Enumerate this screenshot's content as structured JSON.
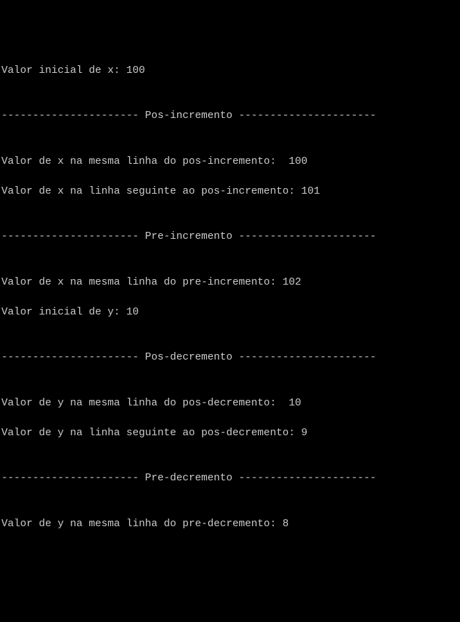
{
  "lines": {
    "l1": "Valor inicial de x: 100",
    "l2": "",
    "l3": "---------------------- Pos-incremento ----------------------",
    "l4": "",
    "l5": "Valor de x na mesma linha do pos-incremento:  100",
    "l6": "Valor de x na linha seguinte ao pos-incremento: 101",
    "l7": "",
    "l8": "---------------------- Pre-incremento ----------------------",
    "l9": "",
    "l10": "Valor de x na mesma linha do pre-incremento: 102",
    "l11": "Valor inicial de y: 10",
    "l12": "",
    "l13": "---------------------- Pos-decremento ----------------------",
    "l14": "",
    "l15": "Valor de y na mesma linha do pos-decremento:  10",
    "l16": "Valor de y na linha seguinte ao pos-decremento: 9",
    "l17": "",
    "l18": "---------------------- Pre-decremento ----------------------",
    "l19": "",
    "l20": "Valor de y na mesma linha do pre-decremento: 8",
    "l21": ""
  }
}
